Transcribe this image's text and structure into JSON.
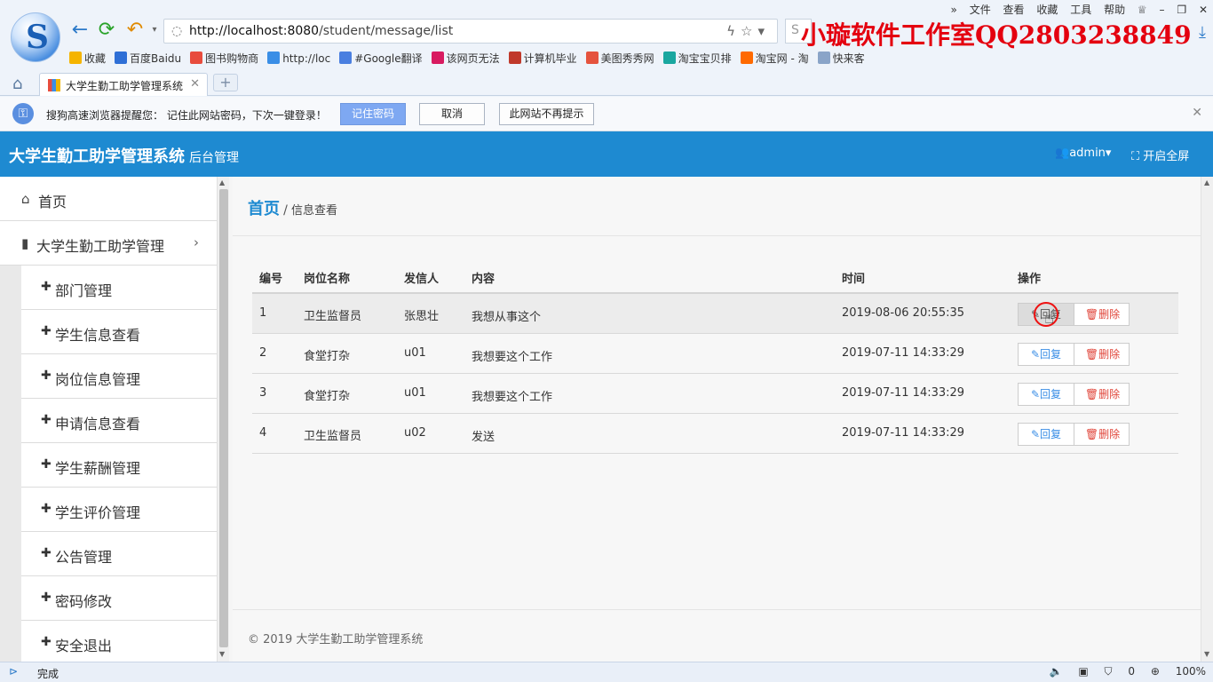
{
  "browser": {
    "url_host": "http://localhost:8080",
    "url_path": "/student/message/list",
    "watermark": "小璇软件工作室QQ2803238849",
    "menu": [
      "»",
      "文件",
      "查看",
      "收藏",
      "工具",
      "帮助"
    ],
    "bookmarks": [
      {
        "label": "收藏",
        "color": "#f5b400"
      },
      {
        "label": "百度Baidu",
        "color": "#2f6fd6"
      },
      {
        "label": "图书购物商",
        "color": "#e84c3d"
      },
      {
        "label": "http://loc",
        "color": "#3a8ee6"
      },
      {
        "label": "#Google翻译",
        "color": "#4a7fe0"
      },
      {
        "label": "该网页无法",
        "color": "#d81b60"
      },
      {
        "label": "计算机毕业",
        "color": "#c0392b"
      },
      {
        "label": "美图秀秀网",
        "color": "#e5533d"
      },
      {
        "label": "淘宝宝贝排",
        "color": "#1aa7a0"
      },
      {
        "label": "淘宝网 - 淘",
        "color": "#ff6a00"
      },
      {
        "label": "快来客",
        "color": "#8aa4c8"
      }
    ],
    "tab_title": "大学生勤工助学管理系统",
    "notify": {
      "message": "搜狗高速浏览器提醒您： 记住此网站密码，下次一键登录！",
      "remember_label": "记住密码",
      "cancel_label": "取消",
      "never_label": "此网站不再提示"
    },
    "status": {
      "done": "完成",
      "count": "0",
      "zoom": "100%"
    }
  },
  "header": {
    "title": "大学生勤工助学管理系统",
    "subtitle": "后台管理",
    "user": "admin",
    "fullscreen": "开启全屏"
  },
  "sidebar": {
    "home": "首页",
    "group": "大学生勤工助学管理",
    "items": [
      "部门管理",
      "学生信息查看",
      "岗位信息管理",
      "申请信息查看",
      "学生薪酬管理",
      "学生评价管理",
      "公告管理",
      "密码修改",
      "安全退出"
    ]
  },
  "breadcrumb": {
    "home": "首页",
    "separator": "/",
    "current": "信息查看"
  },
  "table": {
    "headers": [
      "编号",
      "岗位名称",
      "发信人",
      "内容",
      "时间",
      "操作"
    ],
    "rows": [
      {
        "id": "1",
        "job": "卫生监督员",
        "sender": "张思壮",
        "content": "我想从事这个",
        "time": "2019-08-06 20:55:35"
      },
      {
        "id": "2",
        "job": "食堂打杂",
        "sender": "u01",
        "content": "我想要这个工作",
        "time": "2019-07-11 14:33:29"
      },
      {
        "id": "3",
        "job": "食堂打杂",
        "sender": "u01",
        "content": "我想要这个工作",
        "time": "2019-07-11 14:33:29"
      },
      {
        "id": "4",
        "job": "卫生监督员",
        "sender": "u02",
        "content": "发送",
        "time": "2019-07-11 14:33:29"
      }
    ],
    "reply_label": "回复",
    "delete_label": "删除"
  },
  "footer": "© 2019 大学生勤工助学管理系统"
}
